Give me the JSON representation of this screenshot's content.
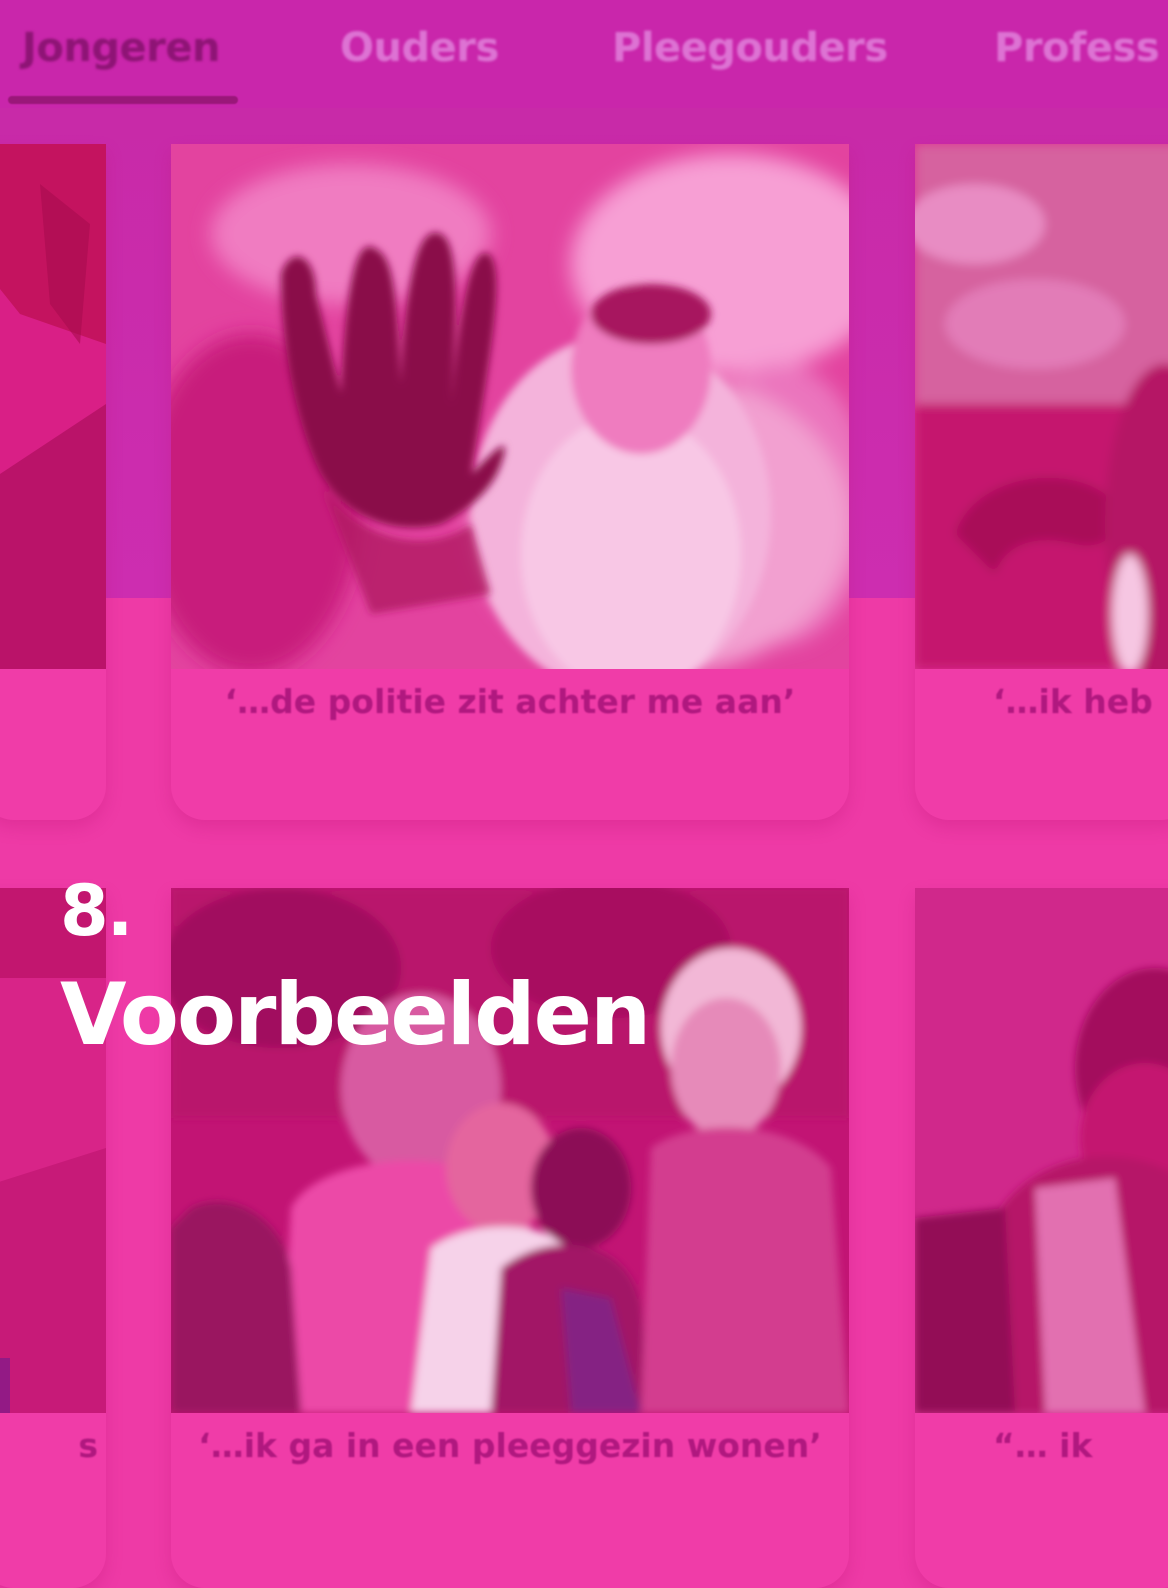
{
  "tabs": [
    {
      "label": "Jongeren",
      "active": true
    },
    {
      "label": "Ouders",
      "active": false
    },
    {
      "label": "Pleegouders",
      "active": false
    },
    {
      "label": "Profess",
      "active": false
    }
  ],
  "colors": {
    "overlay_pink": "#ee3aa6",
    "tabbar_purple": "#c926ab",
    "active_tab": "#8e1475",
    "caption_text": "#b0187f",
    "heading_text": "#ffffff"
  },
  "cards_row1": [
    {
      "caption": "",
      "image": "photo-red-fabric"
    },
    {
      "caption": "‘…de politie zit achter me aan’",
      "image": "photo-boy-reaching-hand"
    },
    {
      "caption": "‘…ik heb",
      "image": "photo-child-with-headphones"
    }
  ],
  "cards_row2": [
    {
      "caption": "s",
      "image": "photo-cropped"
    },
    {
      "caption": "‘…ik ga in een pleeggezin wonen’",
      "image": "photo-foster-family"
    },
    {
      "caption": "“… ik",
      "image": "photo-boy-plaid-shirt"
    }
  ],
  "section": {
    "number": "8.",
    "title": "Voorbeelden"
  }
}
